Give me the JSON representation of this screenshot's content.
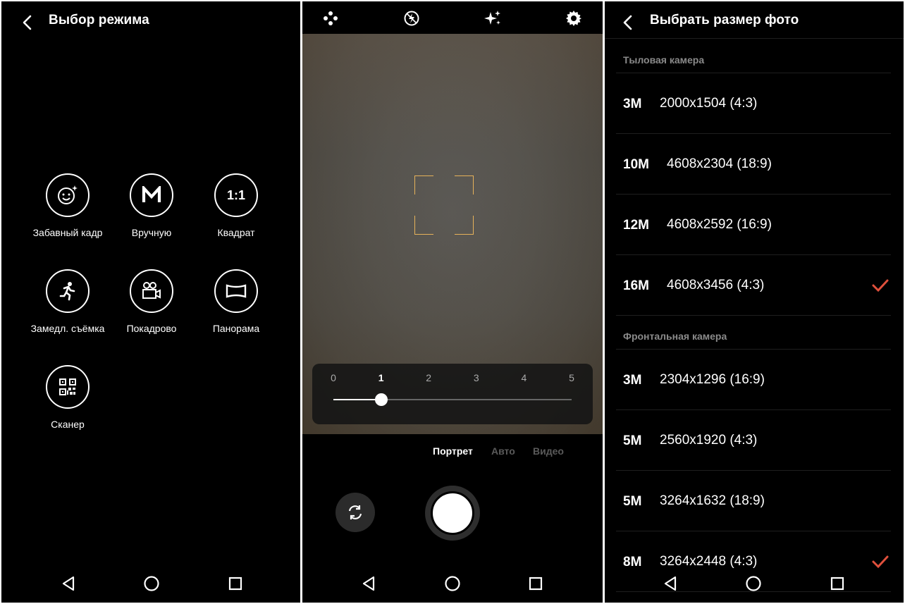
{
  "mode_screen": {
    "title": "Выбор режима",
    "modes": [
      {
        "label": "Забавный кадр",
        "icon": "smile-sparkle-icon"
      },
      {
        "label": "Вручную",
        "icon": "manual-m-icon"
      },
      {
        "label": "Квадрат",
        "icon": "square-ratio-icon",
        "glyph": "1:1"
      },
      {
        "label": "Замедл. съёмка",
        "icon": "running-person-icon"
      },
      {
        "label": "Покадрово",
        "icon": "video-camera-icon"
      },
      {
        "label": "Панорама",
        "icon": "panorama-icon"
      },
      {
        "label": "Сканер",
        "icon": "qr-code-icon"
      }
    ]
  },
  "camera_screen": {
    "top_icons": [
      "dots-icon",
      "flash-auto-icon",
      "sparkle-filter-icon",
      "gear-icon"
    ],
    "zoom": {
      "ticks": [
        "0",
        "1",
        "2",
        "3",
        "4",
        "5"
      ],
      "current": 1,
      "min": 0,
      "max": 5
    },
    "mode_tabs": [
      {
        "label": "Портрет",
        "active": true
      },
      {
        "label": "Авто",
        "active": false
      },
      {
        "label": "Видео",
        "active": false
      }
    ],
    "focus_color": "#e6b25a"
  },
  "size_screen": {
    "title": "Выбрать размер фото",
    "rear_header": "Тыловая камера",
    "rear_sizes": [
      {
        "mp": "3M",
        "res": "2000x1504 (4:3)",
        "selected": false
      },
      {
        "mp": "10M",
        "res": "4608x2304 (18:9)",
        "selected": false
      },
      {
        "mp": "12M",
        "res": "4608x2592 (16:9)",
        "selected": false
      },
      {
        "mp": "16M",
        "res": "4608x3456 (4:3)",
        "selected": true
      }
    ],
    "front_header": "Фронтальная камера",
    "front_sizes": [
      {
        "mp": "3M",
        "res": "2304x1296 (16:9)",
        "selected": false
      },
      {
        "mp": "5M",
        "res": "2560x1920 (4:3)",
        "selected": false
      },
      {
        "mp": "5M",
        "res": "3264x1632 (18:9)",
        "selected": false
      },
      {
        "mp": "8M",
        "res": "3264x2448 (4:3)",
        "selected": true
      }
    ],
    "check_color": "#e0503c"
  }
}
